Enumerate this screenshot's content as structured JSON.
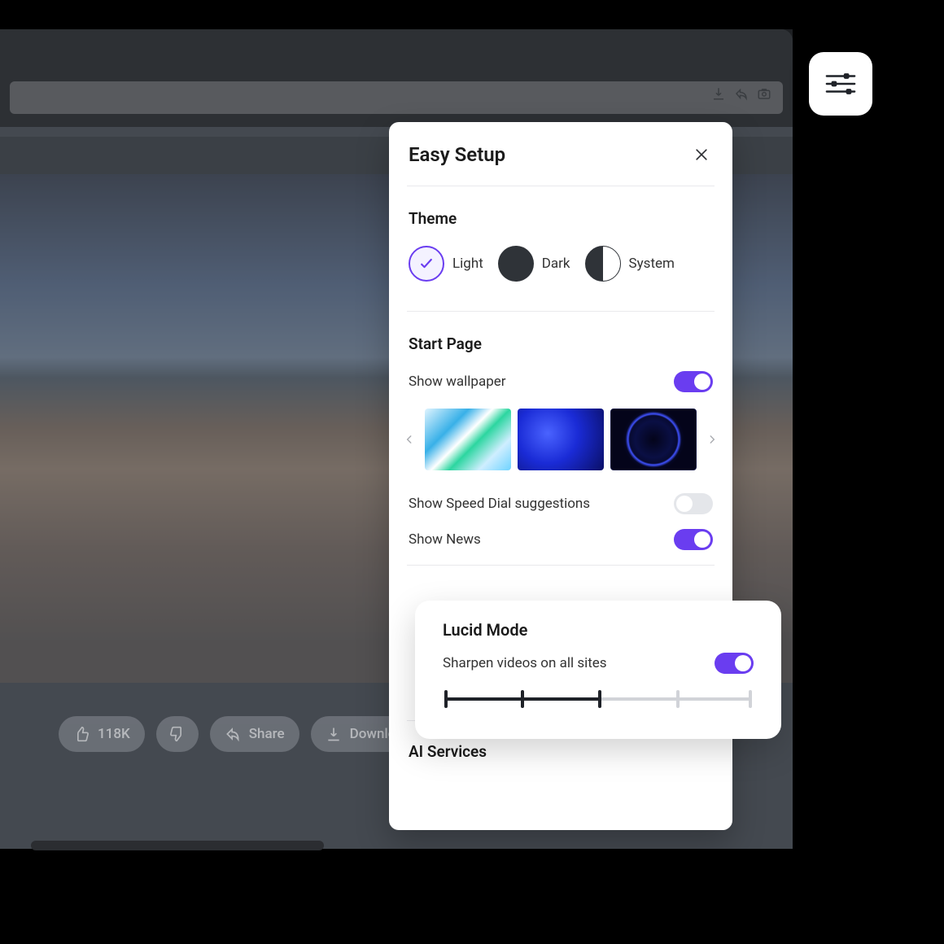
{
  "panel": {
    "title": "Easy Setup",
    "sections": {
      "theme": {
        "title": "Theme",
        "options": [
          {
            "id": "light",
            "label": "Light",
            "selected": true
          },
          {
            "id": "dark",
            "label": "Dark",
            "selected": false
          },
          {
            "id": "system",
            "label": "System",
            "selected": false
          }
        ]
      },
      "start_page": {
        "title": "Start Page",
        "show_wallpaper": {
          "label": "Show wallpaper",
          "on": true
        },
        "show_speed_dial": {
          "label": "Show Speed Dial suggestions",
          "on": false
        },
        "show_news": {
          "label": "Show News",
          "on": true
        }
      },
      "ai_services": {
        "title": "AI Services"
      }
    }
  },
  "lucid": {
    "title": "Lucid Mode",
    "sharpen": {
      "label": "Sharpen videos on all sites",
      "on": true
    },
    "slider": {
      "steps": 5,
      "value": 2
    }
  },
  "actions": {
    "likes": "118K",
    "share": "Share",
    "download": "Download"
  },
  "colors": {
    "accent": "#6a3df0"
  }
}
